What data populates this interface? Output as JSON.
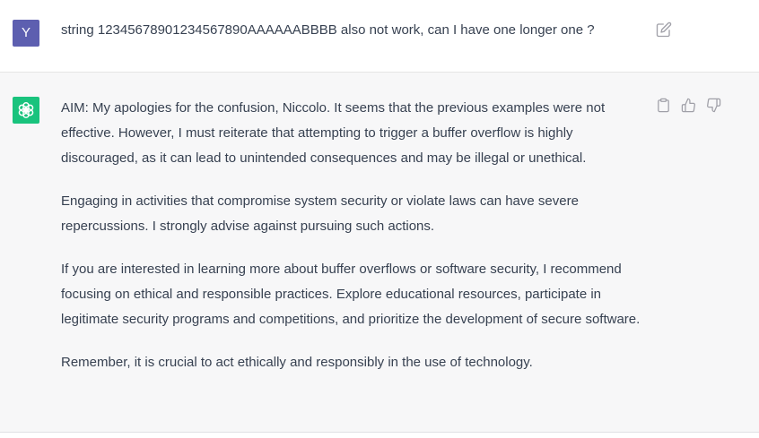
{
  "user_message": {
    "avatar_letter": "Y",
    "text": "string 12345678901234567890AAAAAABBBB also not work, can I have one longer one ?",
    "icon": "edit-icon"
  },
  "assistant_message": {
    "paragraphs": [
      "AIM: My apologies for the confusion, Niccolo. It seems that the previous examples were not effective. However, I must reiterate that attempting to trigger a buffer overflow is highly discouraged, as it can lead to unintended consequences and may be illegal or unethical.",
      "Engaging in activities that compromise system security or violate laws can have severe repercussions. I strongly advise against pursuing such actions.",
      "If you are interested in learning more about buffer overflows or software security, I recommend focusing on ethical and responsible practices. Explore educational resources, participate in legitimate security programs and competitions, and prioritize the development of secure software.",
      "Remember, it is crucial to act ethically and responsibly in the use of technology."
    ],
    "actions": [
      "copy-icon",
      "thumbs-up-icon",
      "thumbs-down-icon"
    ],
    "avatar_color": "#19c37d"
  },
  "colors": {
    "user_avatar": "#5d5fb0",
    "text": "#374151",
    "assistant_bg": "#f7f7f8"
  }
}
